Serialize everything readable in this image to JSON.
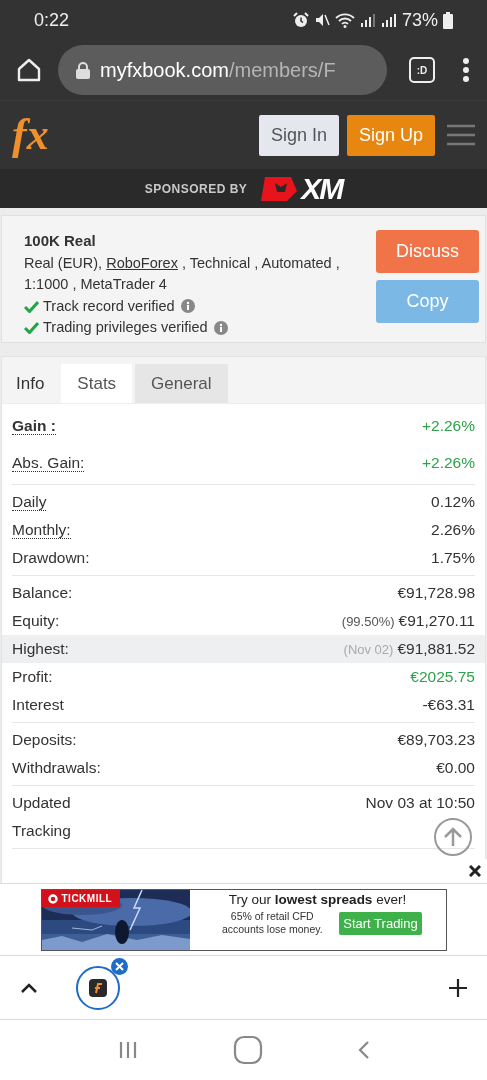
{
  "status_bar": {
    "time": "0:22",
    "battery": "73%"
  },
  "browser": {
    "url_host": "myfxbook.com",
    "url_path": "/members/F",
    "tab_switcher": ":D"
  },
  "site_header": {
    "logo": "fx",
    "buttons": [
      {
        "label": "Sign In",
        "kind": "secondary"
      },
      {
        "label": "Sign Up",
        "kind": "primary"
      }
    ],
    "sponsor_label": "SPONSORED BY",
    "sponsor_name": "XM"
  },
  "account": {
    "title": "100K Real",
    "details_before": "Real (EUR), ",
    "broker": "RoboForex",
    "details_after": " , Technical , Automated , 1:1000 , MetaTrader 4",
    "verifications": [
      {
        "label": "Track record verified",
        "verified": true
      },
      {
        "label": "Trading privileges verified",
        "verified": true
      }
    ],
    "buttons": [
      {
        "label": "Discuss",
        "kind": "discuss"
      },
      {
        "label": "Copy",
        "kind": "copy"
      }
    ]
  },
  "stats": {
    "title": "Info",
    "tabs": [
      {
        "label": "Stats",
        "selected": true
      },
      {
        "label": "General",
        "selected": false
      }
    ],
    "groups": [
      [
        {
          "label": "Gain :",
          "value": "+2.26%",
          "bold": true,
          "dotted": true,
          "highlighted": false,
          "positive": true
        },
        {
          "label": "Abs. Gain:",
          "value": "+2.26%",
          "bold": false,
          "dotted": true,
          "highlighted": false,
          "positive": true
        }
      ],
      [
        {
          "label": "Daily",
          "value": "0.12%",
          "bold": false,
          "dotted": true,
          "highlighted": false,
          "positive": false
        },
        {
          "label": "Monthly:",
          "value": "2.26%",
          "bold": false,
          "dotted": true,
          "highlighted": false,
          "positive": false
        },
        {
          "label": "Drawdown:",
          "value": "1.75%",
          "bold": false,
          "dotted": false,
          "highlighted": false,
          "positive": false
        }
      ],
      [
        {
          "label": "Balance:",
          "value": "€91,728.98",
          "bold": false,
          "dotted": false,
          "highlighted": false,
          "positive": false
        },
        {
          "label": "Equity:",
          "note": "(99.50%)",
          "value": "€91,270.11",
          "bold": false,
          "dotted": false,
          "highlighted": false,
          "positive": false
        },
        {
          "label": "Highest:",
          "note": "(Nov 02)",
          "value": "€91,881.52",
          "bold": false,
          "dotted": false,
          "highlighted": true,
          "positive": false
        },
        {
          "label": "Profit:",
          "value": "€2025.75",
          "bold": false,
          "dotted": false,
          "highlighted": false,
          "positive": true
        },
        {
          "label": "Interest",
          "value": "-€63.31",
          "bold": false,
          "dotted": false,
          "highlighted": false,
          "positive": false
        }
      ],
      [
        {
          "label": "Deposits:",
          "value": "€89,703.23",
          "bold": false,
          "dotted": false,
          "highlighted": false,
          "positive": false
        },
        {
          "label": "Withdrawals:",
          "value": "€0.00",
          "bold": false,
          "dotted": false,
          "highlighted": false,
          "positive": false
        }
      ],
      [
        {
          "label": "Updated",
          "value": "Nov 03 at 10:50",
          "bold": false,
          "dotted": false,
          "highlighted": false,
          "positive": false
        },
        {
          "label": "Tracking",
          "bold": false,
          "dotted": false,
          "highlighted": false
        }
      ]
    ]
  },
  "ad": {
    "brand": "TICKMILL",
    "headline": "Try our **lowest spreads** ever!",
    "disclaimer": "65% of retail CFD accounts lose money.",
    "button": "Start Trading"
  }
}
